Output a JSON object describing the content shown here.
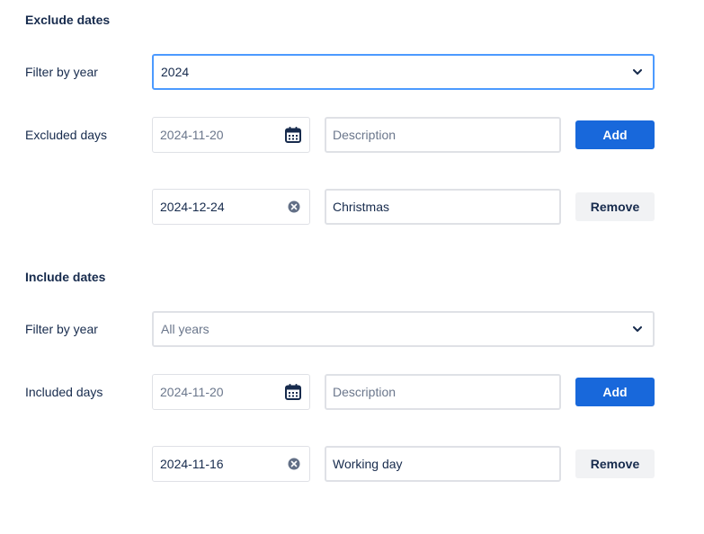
{
  "exclude": {
    "title": "Exclude dates",
    "filter_label": "Filter by year",
    "filter_value": "2024",
    "days_label": "Excluded days",
    "new_entry": {
      "date_placeholder": "2024-11-20",
      "description_placeholder": "Description",
      "add_label": "Add"
    },
    "entries": [
      {
        "date": "2024-12-24",
        "description": "Christmas",
        "remove_label": "Remove"
      }
    ]
  },
  "include": {
    "title": "Include dates",
    "filter_label": "Filter by year",
    "filter_value": "All years",
    "days_label": "Included days",
    "new_entry": {
      "date_placeholder": "2024-11-20",
      "description_placeholder": "Description",
      "add_label": "Add"
    },
    "entries": [
      {
        "date": "2024-11-16",
        "description": "Working day",
        "remove_label": "Remove"
      }
    ]
  },
  "icons": {
    "calendar": "calendar-icon",
    "clear": "clear-icon",
    "chevron": "chevron-down-icon"
  },
  "colors": {
    "primary": "#1868db",
    "focus_border": "#4c9aff",
    "text": "#172b4d",
    "muted": "#6b778c"
  }
}
